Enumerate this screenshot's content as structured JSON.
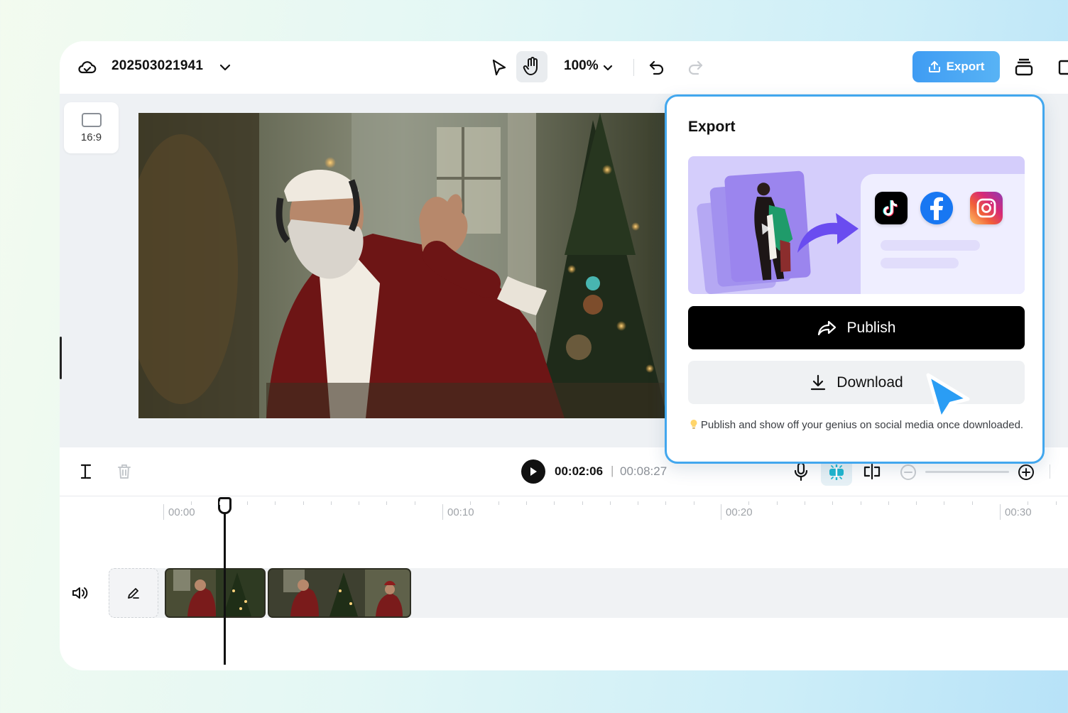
{
  "header": {
    "project_title": "202503021941",
    "zoom_level": "100%",
    "export_label": "Export"
  },
  "canvas": {
    "aspect_ratio": "16:9"
  },
  "playback": {
    "current_time": "00:02:06",
    "separator": "|",
    "total_time": "00:08:27"
  },
  "ruler": {
    "labels": [
      "00:00",
      "00:10",
      "00:20",
      "00:30"
    ]
  },
  "export_panel": {
    "title": "Export",
    "publish_label": "Publish",
    "download_label": "Download",
    "hint_text": "Publish and show off your genius on social media once downloaded.",
    "platforms": [
      "tiktok-icon",
      "facebook-icon",
      "instagram-icon"
    ]
  },
  "colors": {
    "accent": "#42a7ee",
    "export_button": "#3f9cf3",
    "publish_button": "#000000"
  }
}
